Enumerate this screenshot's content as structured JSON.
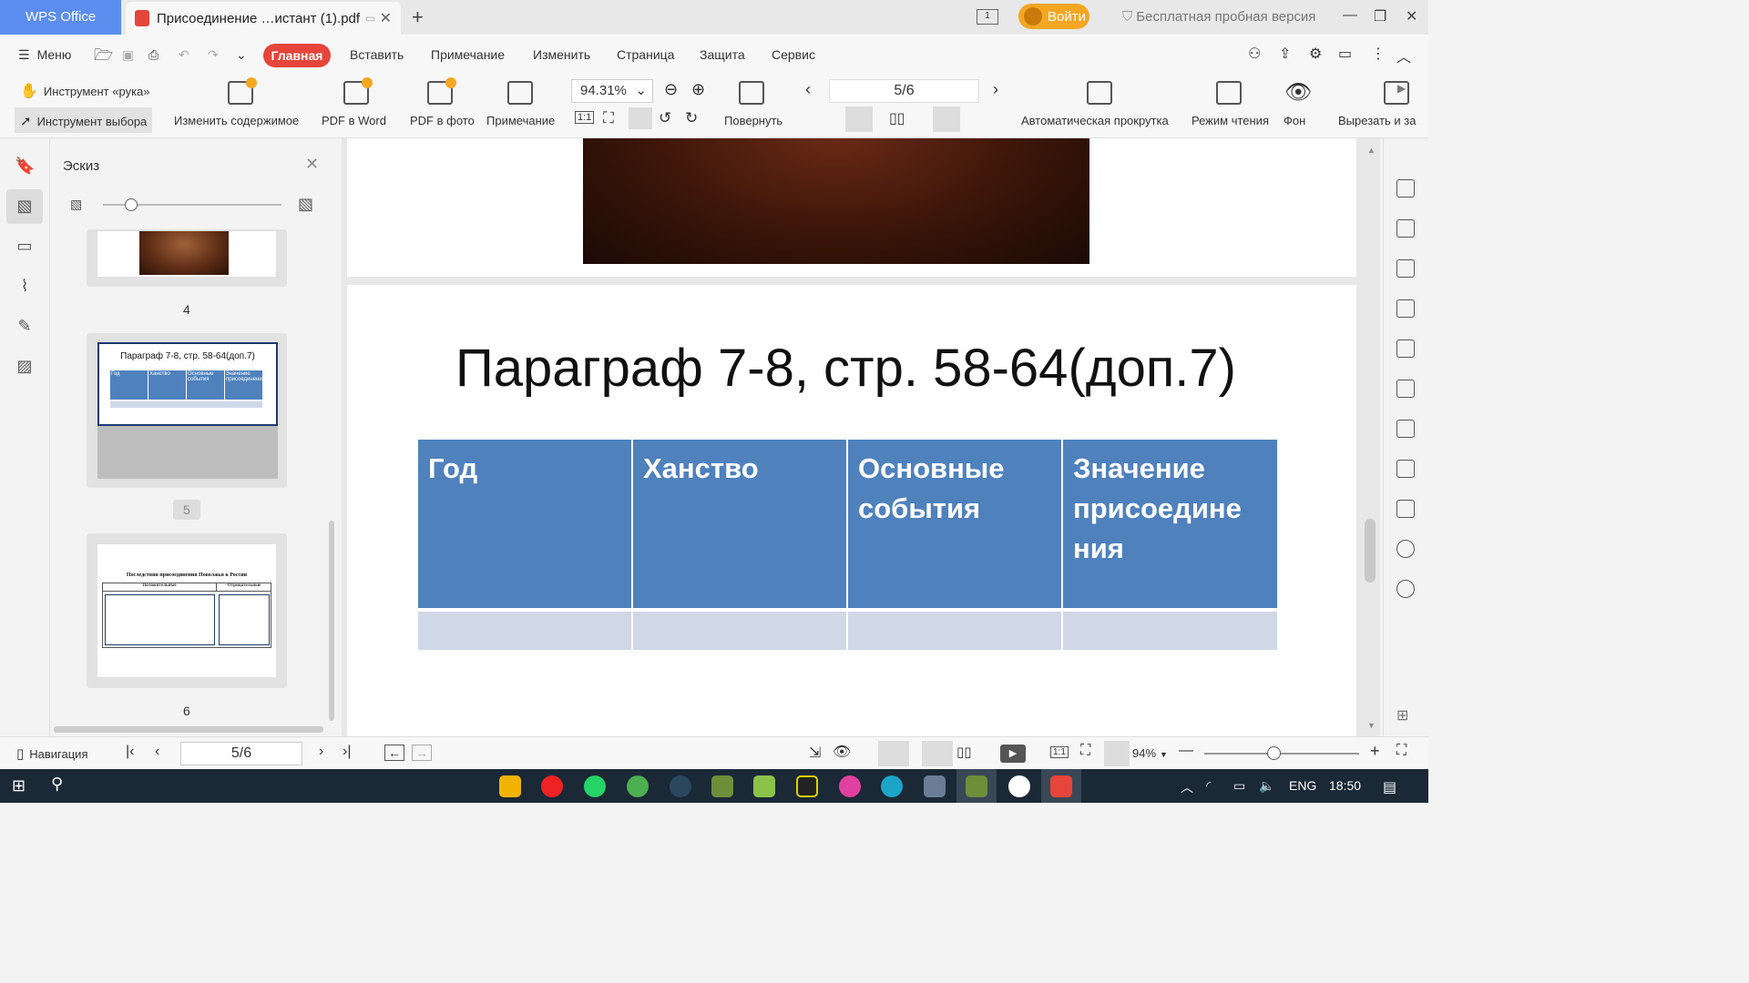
{
  "titlebar": {
    "app_name": "WPS Office",
    "doc_tab": "Присоединение …истант (1).pdf",
    "login": "Войти",
    "trial": "Бесплатная пробная версия",
    "page_indicator": "1"
  },
  "menubar": {
    "menu": "Меню",
    "tabs": [
      "Главная",
      "Вставить",
      "Примечание",
      "Изменить",
      "Страница",
      "Защита",
      "Сервис"
    ]
  },
  "toolbar": {
    "hand_tool": "Инструмент «рука»",
    "select_tool": "Инструмент выбора",
    "edit_content": "Изменить содержимое",
    "pdf_to_word": "PDF в Word",
    "pdf_to_photo": "PDF в фото",
    "annotation": "Примечание",
    "zoom": "94.31%",
    "rotate": "Повернуть",
    "page": "5/6",
    "auto_scroll": "Автоматическая прокрутка",
    "reading_mode": "Режим чтения",
    "background": "Фон",
    "crop": "Вырезать и за"
  },
  "thumbnails": {
    "title": "Эскиз",
    "pages": [
      {
        "num": "4"
      },
      {
        "num": "5",
        "title": "Параграф 7-8, стр. 58-64(доп.7)",
        "cols": [
          "Год",
          "Ханство",
          "Основные события",
          "Значение присоединения"
        ]
      },
      {
        "num": "6",
        "title": "Последствия присоединения Поволжья к России",
        "cols": [
          "Положительные",
          "Отрицательные"
        ]
      }
    ]
  },
  "document": {
    "slide_title": "Параграф 7-8, стр. 58-64(доп.7)",
    "table_headers": [
      "Год",
      "Ханство",
      "Основные события",
      "Значение присоедине ния"
    ],
    "colors": {
      "header": "#4f81bd",
      "row": "#d0d8e8"
    }
  },
  "statusbar": {
    "navigation": "Навигация",
    "page": "5/6",
    "zoom": "94%"
  },
  "taskbar": {
    "lang": "ENG",
    "time": "18:50"
  }
}
